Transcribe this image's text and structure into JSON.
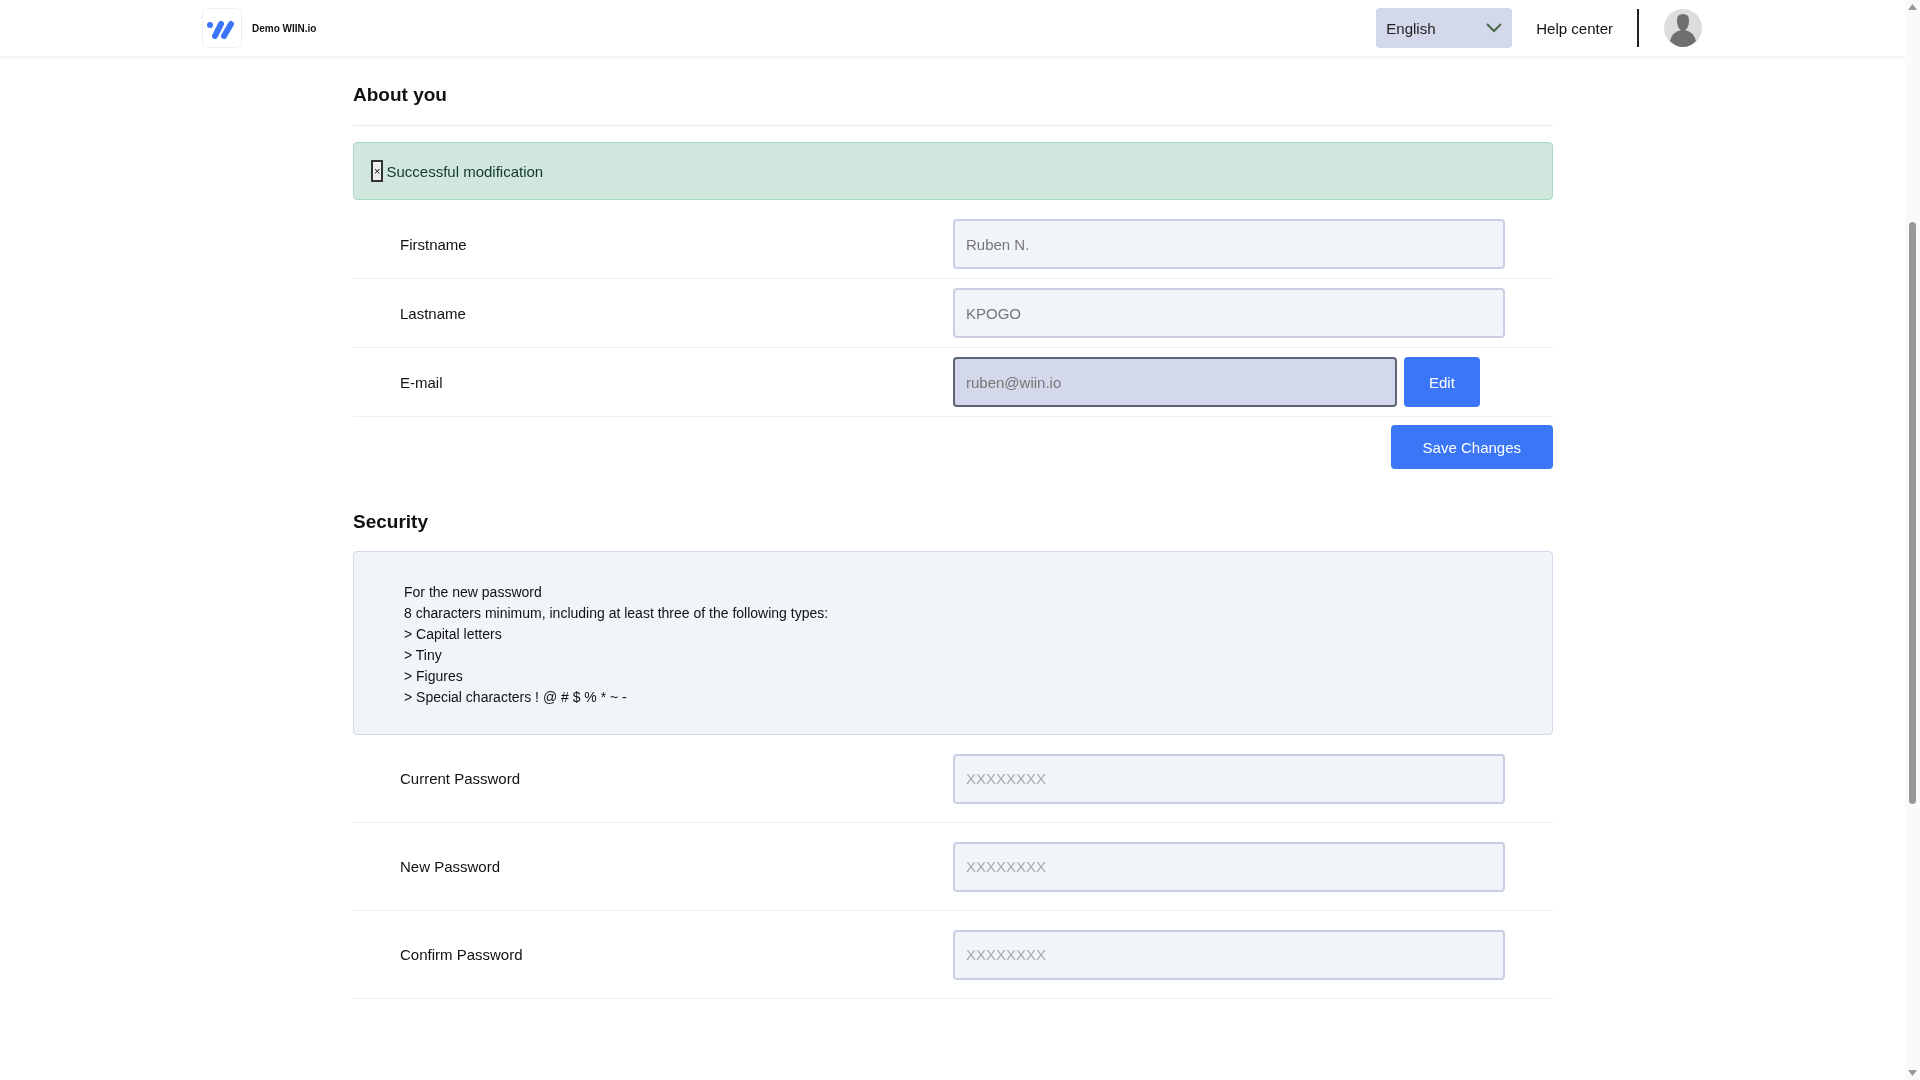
{
  "header": {
    "brand": "Demo WIIN.io",
    "language": "English",
    "help_link": "Help center"
  },
  "about": {
    "title": "About you",
    "alert": {
      "close": "×",
      "message": "Successful modification"
    },
    "fields": [
      {
        "label": "Firstname",
        "value": "Ruben N.",
        "disabled": false
      },
      {
        "label": "Lastname",
        "value": "KPOGO",
        "disabled": false
      },
      {
        "label": "E-mail",
        "value": "ruben@wiin.io",
        "disabled": true,
        "action": "Edit"
      }
    ],
    "save_button": "Save Changes"
  },
  "security": {
    "title": "Security",
    "rules": [
      "For the new password",
      "8 characters minimum, including at least three of the following types:",
      "> Capital letters",
      "> Tiny",
      "> Figures",
      "> Special characters ! @ # $ % * ~ -"
    ],
    "fields": [
      {
        "label": "Current Password",
        "placeholder": "XXXXXXXX"
      },
      {
        "label": "New Password",
        "placeholder": "XXXXXXXX"
      },
      {
        "label": "Confirm Password",
        "placeholder": "XXXXXXXX"
      }
    ]
  }
}
